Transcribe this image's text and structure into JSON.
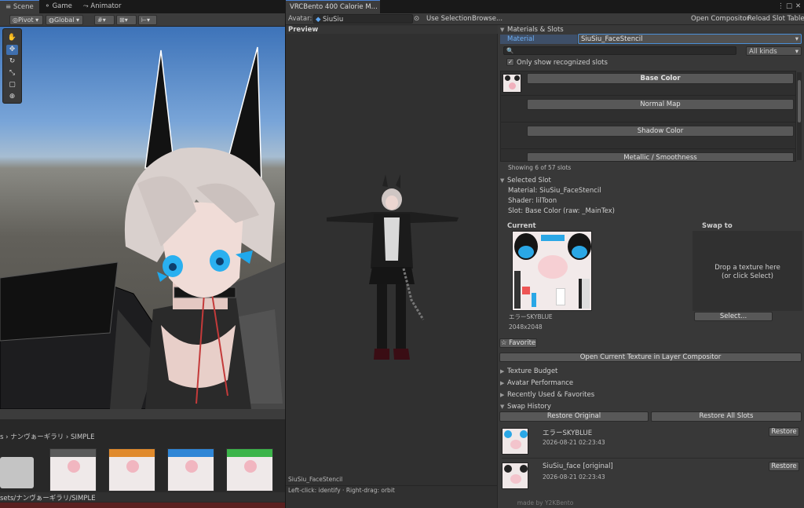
{
  "scene": {
    "tabs": [
      "Scene",
      "Game",
      "Animator"
    ],
    "toolbar": {
      "pivot": "Pivot",
      "global": "Global"
    },
    "tools": [
      "hand-tool-icon",
      "move-tool-icon",
      "rotate-tool-icon",
      "scale-tool-icon",
      "rect-tool-icon",
      "transform-tool-icon"
    ]
  },
  "project": {
    "breadcrumb": "s › ナンヴぁーギラリ › SIMPLE",
    "path": "sets/ナンヴぁーギラリ/SIMPLE",
    "thumb_colors": [
      "#5a5a5a",
      "#e08a2c",
      "#2f86d6",
      "#3cb44a"
    ]
  },
  "bento": {
    "title": "VRCBento 400 Calorie M...",
    "avatar_label": "Avatar:",
    "avatar_value": "SiuSiu",
    "use_selection": "Use Selection",
    "browse": "Browse...",
    "open_compositor": "Open Compositor",
    "reload_slot_table": "Reload Slot Table",
    "preview_label": "Preview",
    "preview_material": "SiuSiu_FaceStencil",
    "preview_hint": "Left-click: identify  ·  Right-drag: orbit",
    "materials_slots": "Materials & Slots",
    "material_label": "Material",
    "material_value": "SiuSiu_FaceStencil",
    "kinds_value": "All kinds",
    "only_recognized": "Only show recognized slots",
    "slots": [
      "Base Color",
      "Normal Map",
      "Shadow Color",
      "Metallic / Smoothness"
    ],
    "showing": "Showing 6 of 57 slots",
    "selected_slot": "Selected Slot",
    "sel_material": "Material: SiuSiu_FaceStencil",
    "sel_shader": "Shader: lilToon",
    "sel_slot": "Slot: Base Color  (raw: _MainTex)",
    "current_label": "Current",
    "swap_to_label": "Swap to",
    "drop_line1": "Drop a texture here",
    "drop_line2": "(or click Select)",
    "tex_name": "エラーSKYBLUE",
    "tex_size": "2048x2048",
    "select_btn": "Select...",
    "favorite": "☆ Favorite",
    "open_layer": "Open Current Texture in Layer Compositor",
    "sections": [
      "Texture Budget",
      "Avatar Performance",
      "Recently Used & Favorites"
    ],
    "swap_history": "Swap History",
    "restore_original": "Restore Original",
    "restore_all": "Restore All Slots",
    "history": [
      {
        "name": "エラーSKYBLUE",
        "time": "2026-08-21 02:23:43",
        "btn": "Restore"
      },
      {
        "name": "SiuSiu_face  [original]",
        "time": "2026-08-21 02:23:43",
        "btn": "Restore"
      }
    ],
    "footer": "made by Y2KBento",
    "accent": "#4a8fd8"
  }
}
